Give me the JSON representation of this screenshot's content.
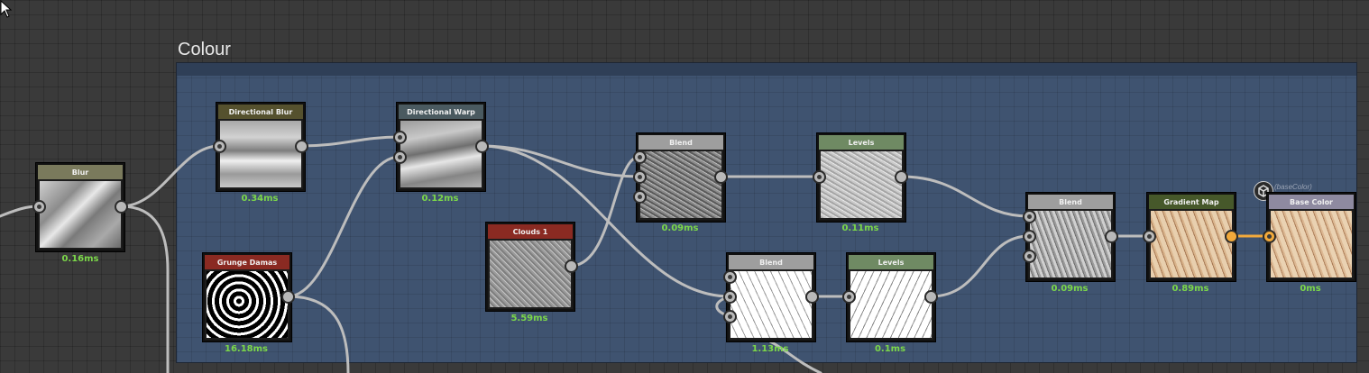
{
  "frame": {
    "title": "Colour"
  },
  "nodes": {
    "blur": {
      "title": "Blur",
      "timing": "0.16ms",
      "header_color": "#7a7a5c"
    },
    "directional_blur": {
      "title": "Directional Blur",
      "timing": "0.34ms",
      "header_color": "#55512e"
    },
    "directional_warp": {
      "title": "Directional Warp",
      "timing": "0.12ms",
      "header_color": "#4a5a60"
    },
    "grunge_damas": {
      "title": "Grunge Damas",
      "timing": "16.18ms",
      "header_color": "#8a2a22"
    },
    "clouds_1": {
      "title": "Clouds 1",
      "timing": "5.59ms",
      "header_color": "#8a2a22"
    },
    "blend_1": {
      "title": "Blend",
      "timing": "0.09ms",
      "header_color": "#9e9e9e"
    },
    "levels_1": {
      "title": "Levels",
      "timing": "0.11ms",
      "header_color": "#6f8a63"
    },
    "blend_2": {
      "title": "Blend",
      "timing": "1.13ms",
      "header_color": "#9e9e9e"
    },
    "levels_2": {
      "title": "Levels",
      "timing": "0.1ms",
      "header_color": "#6f8a63"
    },
    "blend_3": {
      "title": "Blend",
      "timing": "0.09ms",
      "header_color": "#9e9e9e"
    },
    "gradient_map": {
      "title": "Gradient Map",
      "timing": "0.89ms",
      "header_color": "#46582a"
    },
    "base_color": {
      "title": "Base Color",
      "timing": "0ms",
      "header_color": "#8e8aa0",
      "output_label": "(baseColor)"
    }
  },
  "colors": {
    "wire": "#bdbdbd",
    "wire_orange": "#f2a93b",
    "timing_text": "#7cd84a"
  }
}
